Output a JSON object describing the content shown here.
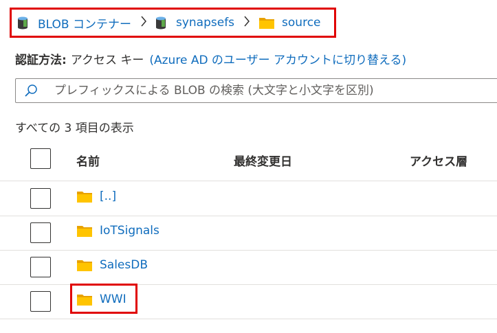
{
  "breadcrumb": {
    "items": [
      {
        "label": "BLOB コンテナー",
        "icon": "container-icon"
      },
      {
        "label": "synapsefs",
        "icon": "container-icon"
      },
      {
        "label": "source",
        "icon": "folder-icon"
      }
    ],
    "separator": ">"
  },
  "auth": {
    "label": "認証方法:",
    "value": "アクセス キー",
    "switch_link": "(Azure AD のユーザー アカウントに切り替える)"
  },
  "search": {
    "placeholder": "プレフィックスによる BLOB の検索 (大文字と小文字を区別)"
  },
  "summary": {
    "count_text": "すべての 3 項目の表示"
  },
  "table": {
    "columns": [
      "名前",
      "最終変更日",
      "アクセス層"
    ],
    "rows": [
      {
        "name": "[..]",
        "icon": "folder-icon"
      },
      {
        "name": "IoTSignals",
        "icon": "folder-icon"
      },
      {
        "name": "SalesDB",
        "icon": "folder-icon"
      },
      {
        "name": "WWI",
        "icon": "folder-icon"
      }
    ]
  },
  "colors": {
    "link": "#0f6cbd",
    "highlight": "#e00000",
    "folder": "#ffc400"
  }
}
